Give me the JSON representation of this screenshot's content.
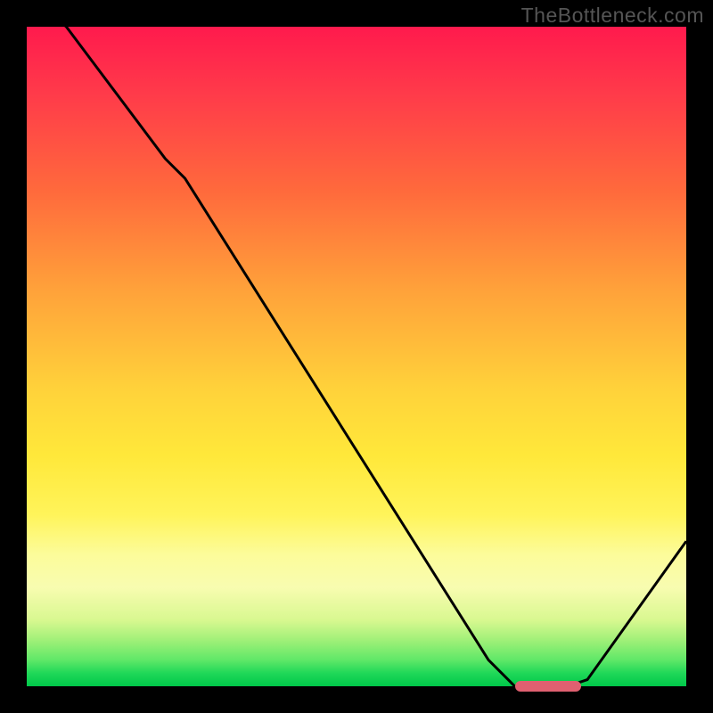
{
  "watermark": "TheBottleneck.com",
  "colors": {
    "frame": "#000000",
    "curve": "#000000",
    "marker": "#e06070",
    "gradient_top": "#ff1a4d",
    "gradient_bottom": "#00c84a"
  },
  "chart_data": {
    "type": "line",
    "title": "",
    "xlabel": "",
    "ylabel": "",
    "xlim": [
      0,
      100
    ],
    "ylim": [
      0,
      100
    ],
    "x": [
      0,
      6,
      21,
      24,
      70,
      74,
      82,
      85,
      100
    ],
    "values": [
      105,
      100,
      80,
      77,
      4,
      0,
      0,
      1,
      22
    ],
    "marker": {
      "x_start": 74,
      "x_end": 84,
      "y": 0
    },
    "note": "x and y in 0-100 coordinate units of the plot area; values read approximately from the figure"
  }
}
